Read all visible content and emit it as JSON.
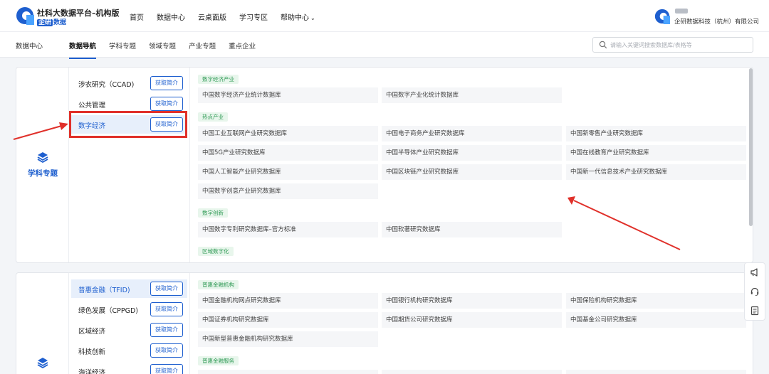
{
  "brand": {
    "title": "社科大数据平台–机构版",
    "tag": "企研",
    "tag_suffix": "数据"
  },
  "top_nav": [
    "首页",
    "数据中心",
    "云桌面版",
    "学习专区",
    "帮助中心"
  ],
  "user": {
    "company": "企研数据科技（杭州）有限公司"
  },
  "sub_nav": {
    "home": "数据中心",
    "items": [
      "数据导航",
      "学科专题",
      "领域专题",
      "产业专题",
      "重点企业"
    ],
    "active": "数据导航"
  },
  "search": {
    "placeholder": "请输入关键词搜索数据库/表格等"
  },
  "panel1": {
    "title": "学科专题",
    "subjects": [
      {
        "name": "涉农研究（CCAD)",
        "button": "获取简介"
      },
      {
        "name": "公共管理",
        "button": "获取简介"
      },
      {
        "name": "数字经济",
        "button": "获取简介"
      }
    ],
    "categories": [
      {
        "name": "数字经济产业",
        "dbs": [
          "中国数字经济产业统计数据库",
          "中国数字产业化统计数据库"
        ]
      },
      {
        "name": "热点产业",
        "dbs": [
          "中国工业互联网产业研究数据库",
          "中国电子商务产业研究数据库",
          "中国新零售产业研究数据库",
          "中国5G产业研究数据库",
          "中国半导体产业研究数据库",
          "中国在线教育产业研究数据库",
          "中国人工智能产业研究数据库",
          "中国区块链产业研究数据库",
          "中国新一代信息技术产业研究数据库",
          "中国数字创意产业研究数据库"
        ]
      },
      {
        "name": "数字创新",
        "dbs": [
          "中国数字专利研究数据库–官方标准",
          "中国软著研究数据库"
        ]
      },
      {
        "name": "区域数字化",
        "dbs": []
      }
    ]
  },
  "panel2": {
    "subjects": [
      {
        "name": "普惠金融（TFID)",
        "button": "获取简介"
      },
      {
        "name": "绿色发展（CPPGD)",
        "button": "获取简介"
      },
      {
        "name": "区域经济",
        "button": "获取简介"
      },
      {
        "name": "科技创新",
        "button": "获取简介"
      },
      {
        "name": "海洋经济",
        "button": "获取简介"
      }
    ],
    "categories": [
      {
        "name": "普惠金融机构",
        "dbs": [
          "中国金融机构网点研究数据库",
          "中国银行机构研究数据库",
          "中国保险机构研究数据库",
          "中国证券机构研究数据库",
          "中国期货公司研究数据库",
          "中国基金公司研究数据库",
          "中国新型普惠金融机构研究数据库"
        ]
      },
      {
        "name": "普惠金融服务",
        "dbs": []
      }
    ]
  },
  "colors": {
    "accent": "#1e5fcf",
    "tag_green": "#2f9a55",
    "highlight_red": "#e0302a"
  }
}
